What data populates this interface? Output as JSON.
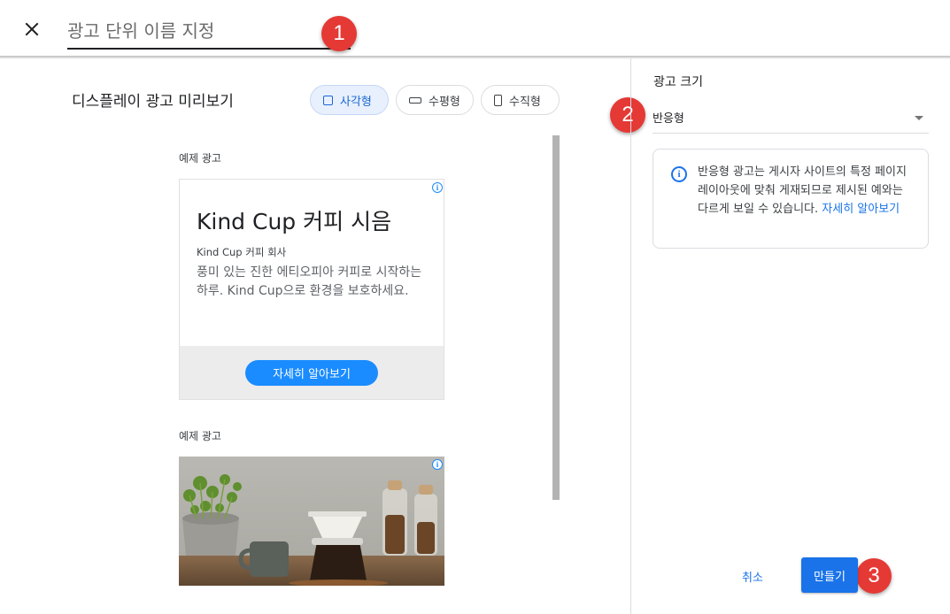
{
  "header": {
    "name_placeholder": "광고 단위 이름 지정",
    "close_icon": "close-icon"
  },
  "markers": [
    "1",
    "2",
    "3"
  ],
  "preview": {
    "title": "디스플레이 광고 미리보기",
    "shapes": [
      {
        "label": "사각형",
        "icon": "square-icon",
        "active": true
      },
      {
        "label": "수평형",
        "icon": "horizontal-icon",
        "active": false
      },
      {
        "label": "수직형",
        "icon": "vertical-icon",
        "active": false
      }
    ],
    "ads": [
      {
        "label": "예제 광고",
        "headline": "Kind Cup 커피 시음",
        "advertiser": "Kind Cup 커피 회사",
        "description": "풍미 있는 진한 에티오피아 커피로 시작하는 하루. Kind Cup으로 환경을 보호하세요.",
        "cta": "자세히 알아보기"
      },
      {
        "label": "예제 광고"
      }
    ],
    "adchoices_icon": "info-icon"
  },
  "settings": {
    "size_label": "광고 크기",
    "size_value": "반응형",
    "info_text": "반응형 광고는 게시자 사이트의 특정 페이지 레이아웃에 맞춰 게재되므로 제시된 예와는 다르게 보일 수 있습니다.",
    "info_link": "자세히 알아보기",
    "cancel_label": "취소",
    "create_label": "만들기"
  },
  "colors": {
    "accent": "#1a73e8",
    "cta_blue": "#1a8cff",
    "marker_red": "#e53935",
    "chip_active_bg": "#e8f0fe"
  }
}
